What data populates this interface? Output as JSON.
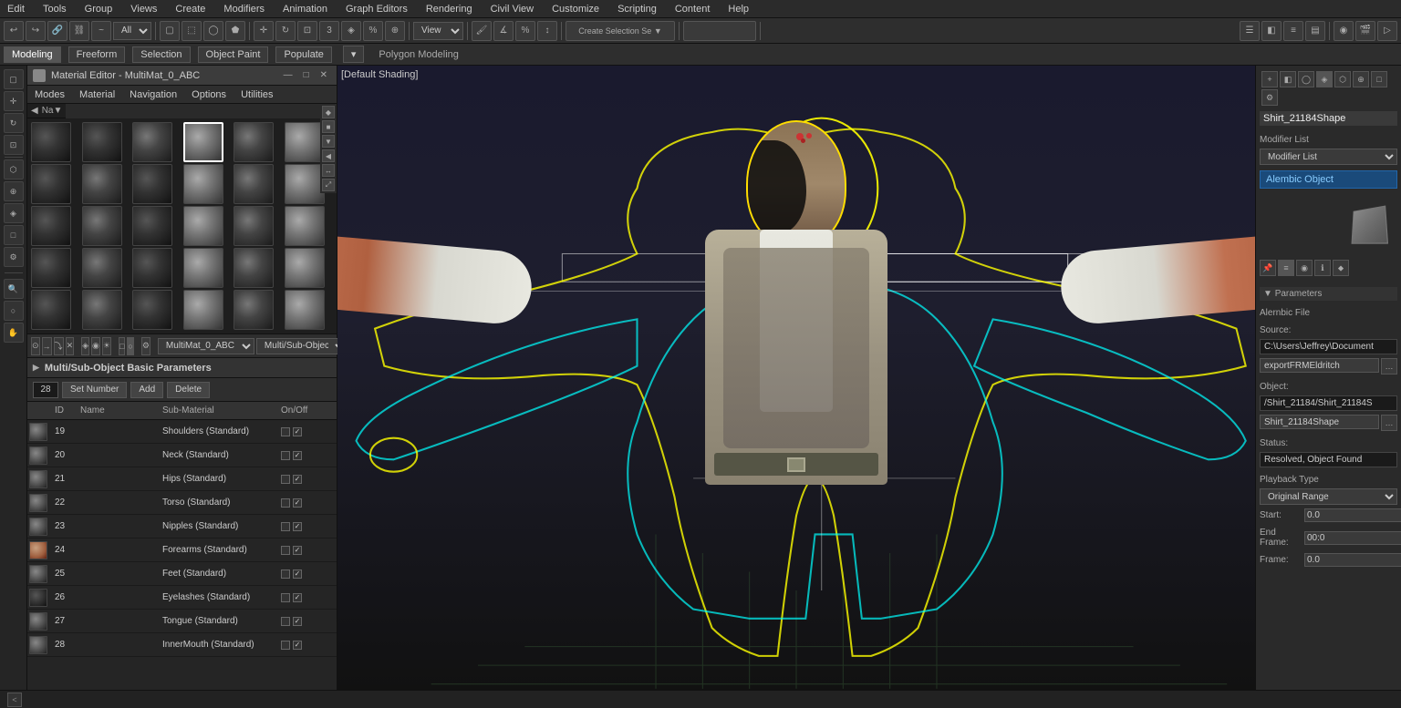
{
  "menubar": {
    "items": [
      "Edit",
      "Tools",
      "Group",
      "Views",
      "Create",
      "Modifiers",
      "Animation",
      "Graph Editors",
      "Rendering",
      "Civil View",
      "Customize",
      "Scripting",
      "Content",
      "Help"
    ]
  },
  "toolbar": {
    "view_dropdown": "View",
    "create_selection": "Create Selection Se ▼"
  },
  "toolbar2": {
    "tabs": [
      "Modeling",
      "Freeform",
      "Selection",
      "Object Paint",
      "Populate"
    ],
    "active_tab": "Modeling",
    "subtitle": "Polygon Modeling"
  },
  "material_editor": {
    "title": "Material Editor - MultiMat_0_ABC",
    "menus": [
      "Modes",
      "Material",
      "Navigation",
      "Options",
      "Utilities"
    ],
    "samples": [
      {
        "type": "dark"
      },
      {
        "type": "mid"
      },
      {
        "type": "dark"
      },
      {
        "type": "grey"
      },
      {
        "type": "grey"
      },
      {
        "type": "grey"
      },
      {
        "type": "dark"
      },
      {
        "type": "mid"
      },
      {
        "type": "dark"
      },
      {
        "type": "grey"
      },
      {
        "type": "grey"
      },
      {
        "type": "grey"
      },
      {
        "type": "dark"
      },
      {
        "type": "mid"
      },
      {
        "type": "dark"
      },
      {
        "type": "grey"
      },
      {
        "type": "grey"
      },
      {
        "type": "grey"
      },
      {
        "type": "dark"
      },
      {
        "type": "mid"
      },
      {
        "type": "dark"
      },
      {
        "type": "grey"
      },
      {
        "type": "grey"
      },
      {
        "type": "grey"
      },
      {
        "type": "dark"
      },
      {
        "type": "mid"
      },
      {
        "type": "dark"
      },
      {
        "type": "grey"
      },
      {
        "type": "grey"
      },
      {
        "type": "grey"
      }
    ],
    "mat_name": "MultiMat_0_ABC",
    "mat_type": "Multi/Sub-Object",
    "multi_sub_header": "Multi/Sub-Object Basic Parameters",
    "controls": {
      "count": "28",
      "set_number_label": "Set Number",
      "add_label": "Add",
      "delete_label": "Delete"
    },
    "table_headers": [
      "",
      "ID",
      "Name",
      "Sub-Material",
      "On/Off"
    ],
    "rows": [
      {
        "id": "19",
        "name": "",
        "sub": "Shoulders (Standard)",
        "thumb": "grey",
        "on": true,
        "off": false
      },
      {
        "id": "20",
        "name": "",
        "sub": "Neck (Standard)",
        "thumb": "grey",
        "on": true,
        "off": false
      },
      {
        "id": "21",
        "name": "",
        "sub": "Hips (Standard)",
        "thumb": "grey",
        "on": true,
        "off": false
      },
      {
        "id": "22",
        "name": "",
        "sub": "Torso (Standard)",
        "thumb": "grey",
        "on": true,
        "off": false
      },
      {
        "id": "23",
        "name": "",
        "sub": "Nipples (Standard)",
        "thumb": "grey",
        "on": true,
        "off": false
      },
      {
        "id": "24",
        "name": "",
        "sub": "Forearms (Standard)",
        "thumb": "skin",
        "on": true,
        "off": false
      },
      {
        "id": "25",
        "name": "",
        "sub": "Feet (Standard)",
        "thumb": "grey",
        "on": true,
        "off": false
      },
      {
        "id": "26",
        "name": "",
        "sub": "Eyelashes (Standard)",
        "thumb": "dark",
        "on": true,
        "off": false
      },
      {
        "id": "27",
        "name": "",
        "sub": "Tongue (Standard)",
        "thumb": "grey",
        "on": true,
        "off": false
      },
      {
        "id": "28",
        "name": "",
        "sub": "InnerMouth (Standard)",
        "thumb": "grey",
        "on": true,
        "off": false
      }
    ]
  },
  "viewport": {
    "label": "[Default Shading]"
  },
  "right_panel": {
    "object_name": "Shirt_21184Shape",
    "modifier_list_label": "Modifier List",
    "alembic_object": "Alembic Object",
    "parameters_label": "Parameters",
    "alembic_file_label": "Alernbic File",
    "source_label": "Source:",
    "source_value": "C:\\Users\\Jeffrey\\Document",
    "object_field_label": "Object:",
    "object_path": "/Shirt_21184/Shirt_21184S",
    "object_input": "Shirt_21184Shape",
    "status_label": "Status:",
    "status_value": "Resolved, Object Found",
    "playback_label": "Playback Type",
    "playback_value": "Original Range",
    "start_label": "Start:",
    "start_value": "0.0",
    "end_frame_label": "End Frame:",
    "end_frame_value": "00:0",
    "frame_label": "Frame:",
    "frame_value": "0.0"
  },
  "status_bar": {
    "arrow_label": "<"
  }
}
